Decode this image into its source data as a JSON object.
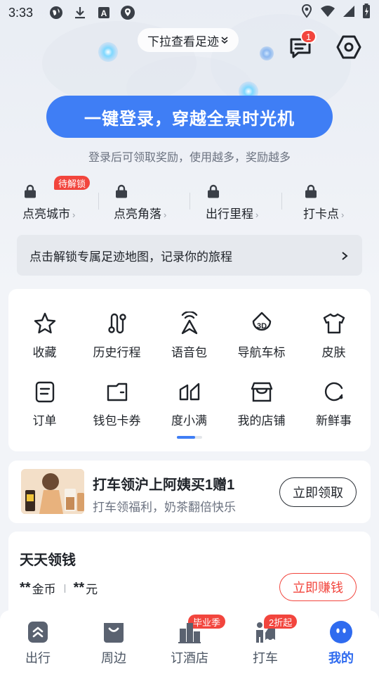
{
  "status_bar": {
    "time": "3:33",
    "left_icons": [
      "globe-icon",
      "download-icon",
      "a-box-icon",
      "map-pin-app-icon"
    ],
    "right_icons": [
      "location-icon",
      "wifi-icon",
      "signal-icon",
      "battery-icon"
    ]
  },
  "header": {
    "pull_hint": "下拉查看足迹",
    "message_badge": "1"
  },
  "login": {
    "button_label": "一键登录，穿越全景时光机",
    "subtitle": "登录后可领取奖励，使用越多，奖励越多"
  },
  "stats": [
    {
      "label": "点亮城市",
      "tag": "待解锁"
    },
    {
      "label": "点亮角落"
    },
    {
      "label": "出行里程"
    },
    {
      "label": "打卡点"
    }
  ],
  "unlock_bar": {
    "text": "点击解锁专属足迹地图，记录你的旅程"
  },
  "tools": [
    {
      "label": "收藏",
      "icon": "star-icon"
    },
    {
      "label": "历史行程",
      "icon": "route-icon"
    },
    {
      "label": "语音包",
      "icon": "voice-tower-icon"
    },
    {
      "label": "导航车标",
      "icon": "3d-marker-icon"
    },
    {
      "label": "皮肤",
      "icon": "shirt-icon"
    },
    {
      "label": "订单",
      "icon": "order-icon"
    },
    {
      "label": "钱包卡券",
      "icon": "wallet-icon"
    },
    {
      "label": "度小满",
      "icon": "duxiaoman-icon"
    },
    {
      "label": "我的店铺",
      "icon": "shop-icon"
    },
    {
      "label": "新鲜事",
      "icon": "fresh-news-icon"
    }
  ],
  "promo": {
    "title": "打车领沪上阿姨买1赠1",
    "subtitle": "打车领福利，奶茶翻倍快乐",
    "button": "立即领取"
  },
  "money": {
    "title": "天天领钱",
    "coins_value": "**",
    "coins_unit": "金币",
    "cash_value": "**",
    "cash_unit": "元",
    "button": "立即赚钱"
  },
  "tabbar": [
    {
      "label": "出行",
      "icon": "travel-icon"
    },
    {
      "label": "周边",
      "icon": "nearby-icon"
    },
    {
      "label": "订酒店",
      "icon": "hotel-icon",
      "badge": "毕业季"
    },
    {
      "label": "打车",
      "icon": "taxi-icon",
      "badge": "2折起"
    },
    {
      "label": "我的",
      "icon": "me-icon",
      "active": true
    }
  ],
  "colors": {
    "accent": "#3f7ef5",
    "badge_red": "#f2453d",
    "active_tab": "#2f6bef"
  }
}
